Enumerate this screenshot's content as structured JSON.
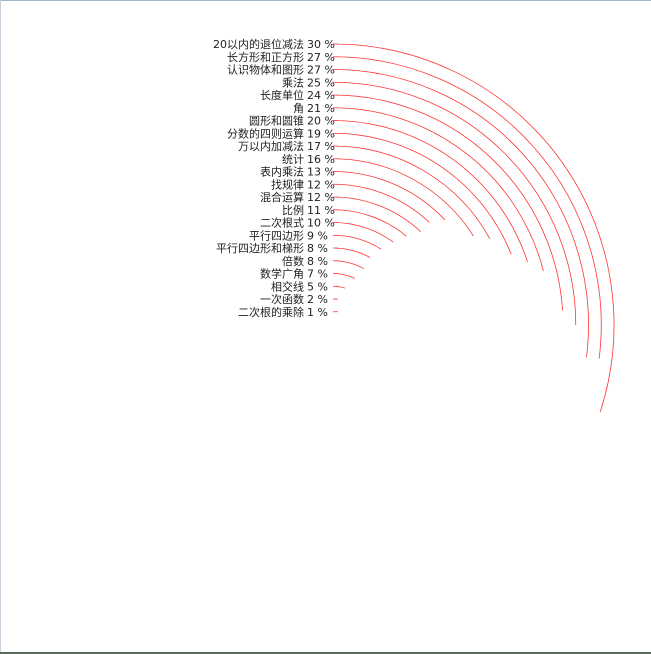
{
  "chart_data": {
    "type": "radial-bar",
    "arc_color": "#ff3333",
    "max_value": 100,
    "categories": [
      "20以内的退位减法",
      "长方形和正方形",
      "认识物体和图形",
      "乘法",
      "长度单位",
      "角",
      "圆形和圆锥",
      "分数的四则运算",
      "万以内加减法",
      "统计",
      "表内乘法",
      "找规律",
      "混合运算",
      "比例",
      "二次根式",
      "平行四边形",
      "平行四边形和梯形",
      "倍数",
      "数学广角",
      "相交线",
      "一次函数",
      "二次根的乘除"
    ],
    "values": [
      30,
      27,
      27,
      25,
      24,
      21,
      20,
      19,
      17,
      16,
      13,
      12,
      12,
      11,
      10,
      9,
      8,
      8,
      7,
      5,
      2,
      1
    ],
    "value_labels": [
      "30 %",
      "27 %",
      "27 %",
      "25 %",
      "24 %",
      "21 %",
      "20 %",
      "19 %",
      "17 %",
      "16 %",
      "13 %",
      "12 %",
      "12 %",
      "11 %",
      "10 %",
      "9 %",
      "8 %",
      "8 %",
      "7 %",
      "5 %",
      "2 %",
      "1 %"
    ]
  }
}
